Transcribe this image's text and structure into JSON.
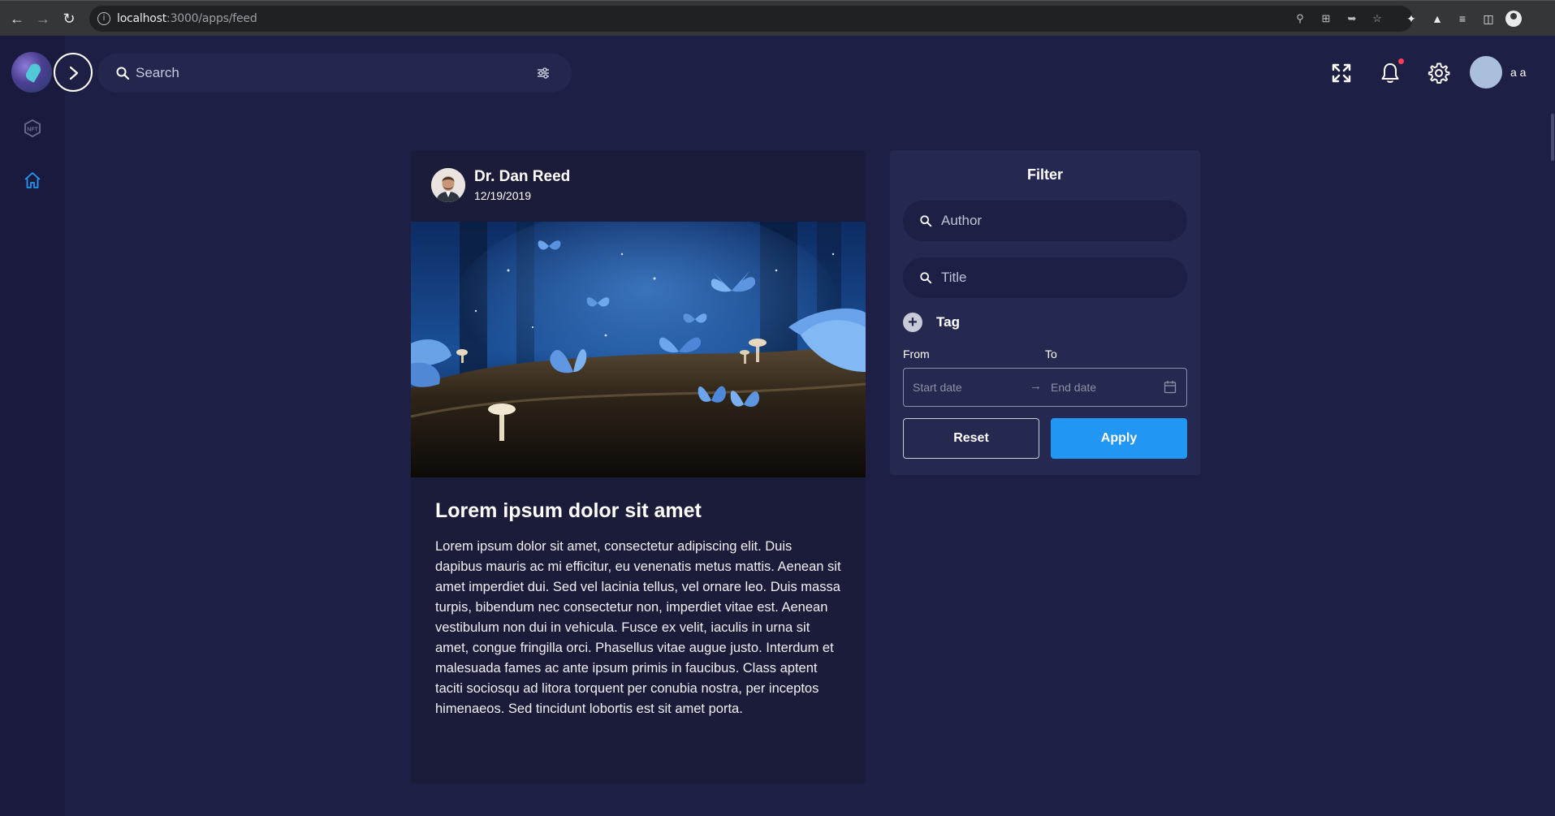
{
  "browser": {
    "url_host": "localhost",
    "url_path": ":3000/apps/feed"
  },
  "header": {
    "search_placeholder": "Search",
    "user_name": "a a"
  },
  "post": {
    "author": "Dr. Dan Reed",
    "date": "12/19/2019",
    "title": "Lorem ipsum dolor sit amet",
    "body": "Lorem ipsum dolor sit amet, consectetur adipiscing elit. Duis dapibus mauris ac mi efficitur, eu venenatis metus mattis. Aenean sit amet imperdiet dui. Sed vel lacinia tellus, vel ornare leo. Duis massa turpis, bibendum nec consectetur non, imperdiet vitae est. Aenean vestibulum non dui in vehicula. Fusce ex velit, iaculis in urna sit amet, congue fringilla orci. Phasellus vitae augue justo. Interdum et malesuada fames ac ante ipsum primis in faucibus. Class aptent taciti sociosqu ad litora torquent per conubia nostra, per inceptos himenaeos. Sed tincidunt lobortis est sit amet porta."
  },
  "filter": {
    "title": "Filter",
    "author_placeholder": "Author",
    "title_placeholder": "Title",
    "tag_label": "Tag",
    "from_label": "From",
    "to_label": "To",
    "start_placeholder": "Start date",
    "end_placeholder": "End date",
    "reset_label": "Reset",
    "apply_label": "Apply"
  },
  "colors": {
    "background": "#1d1f45",
    "sidebar": "#191a3d",
    "card": "#1a1c3a",
    "panel": "#25284f",
    "accent": "#2196f3",
    "notification": "#ff3d57"
  }
}
